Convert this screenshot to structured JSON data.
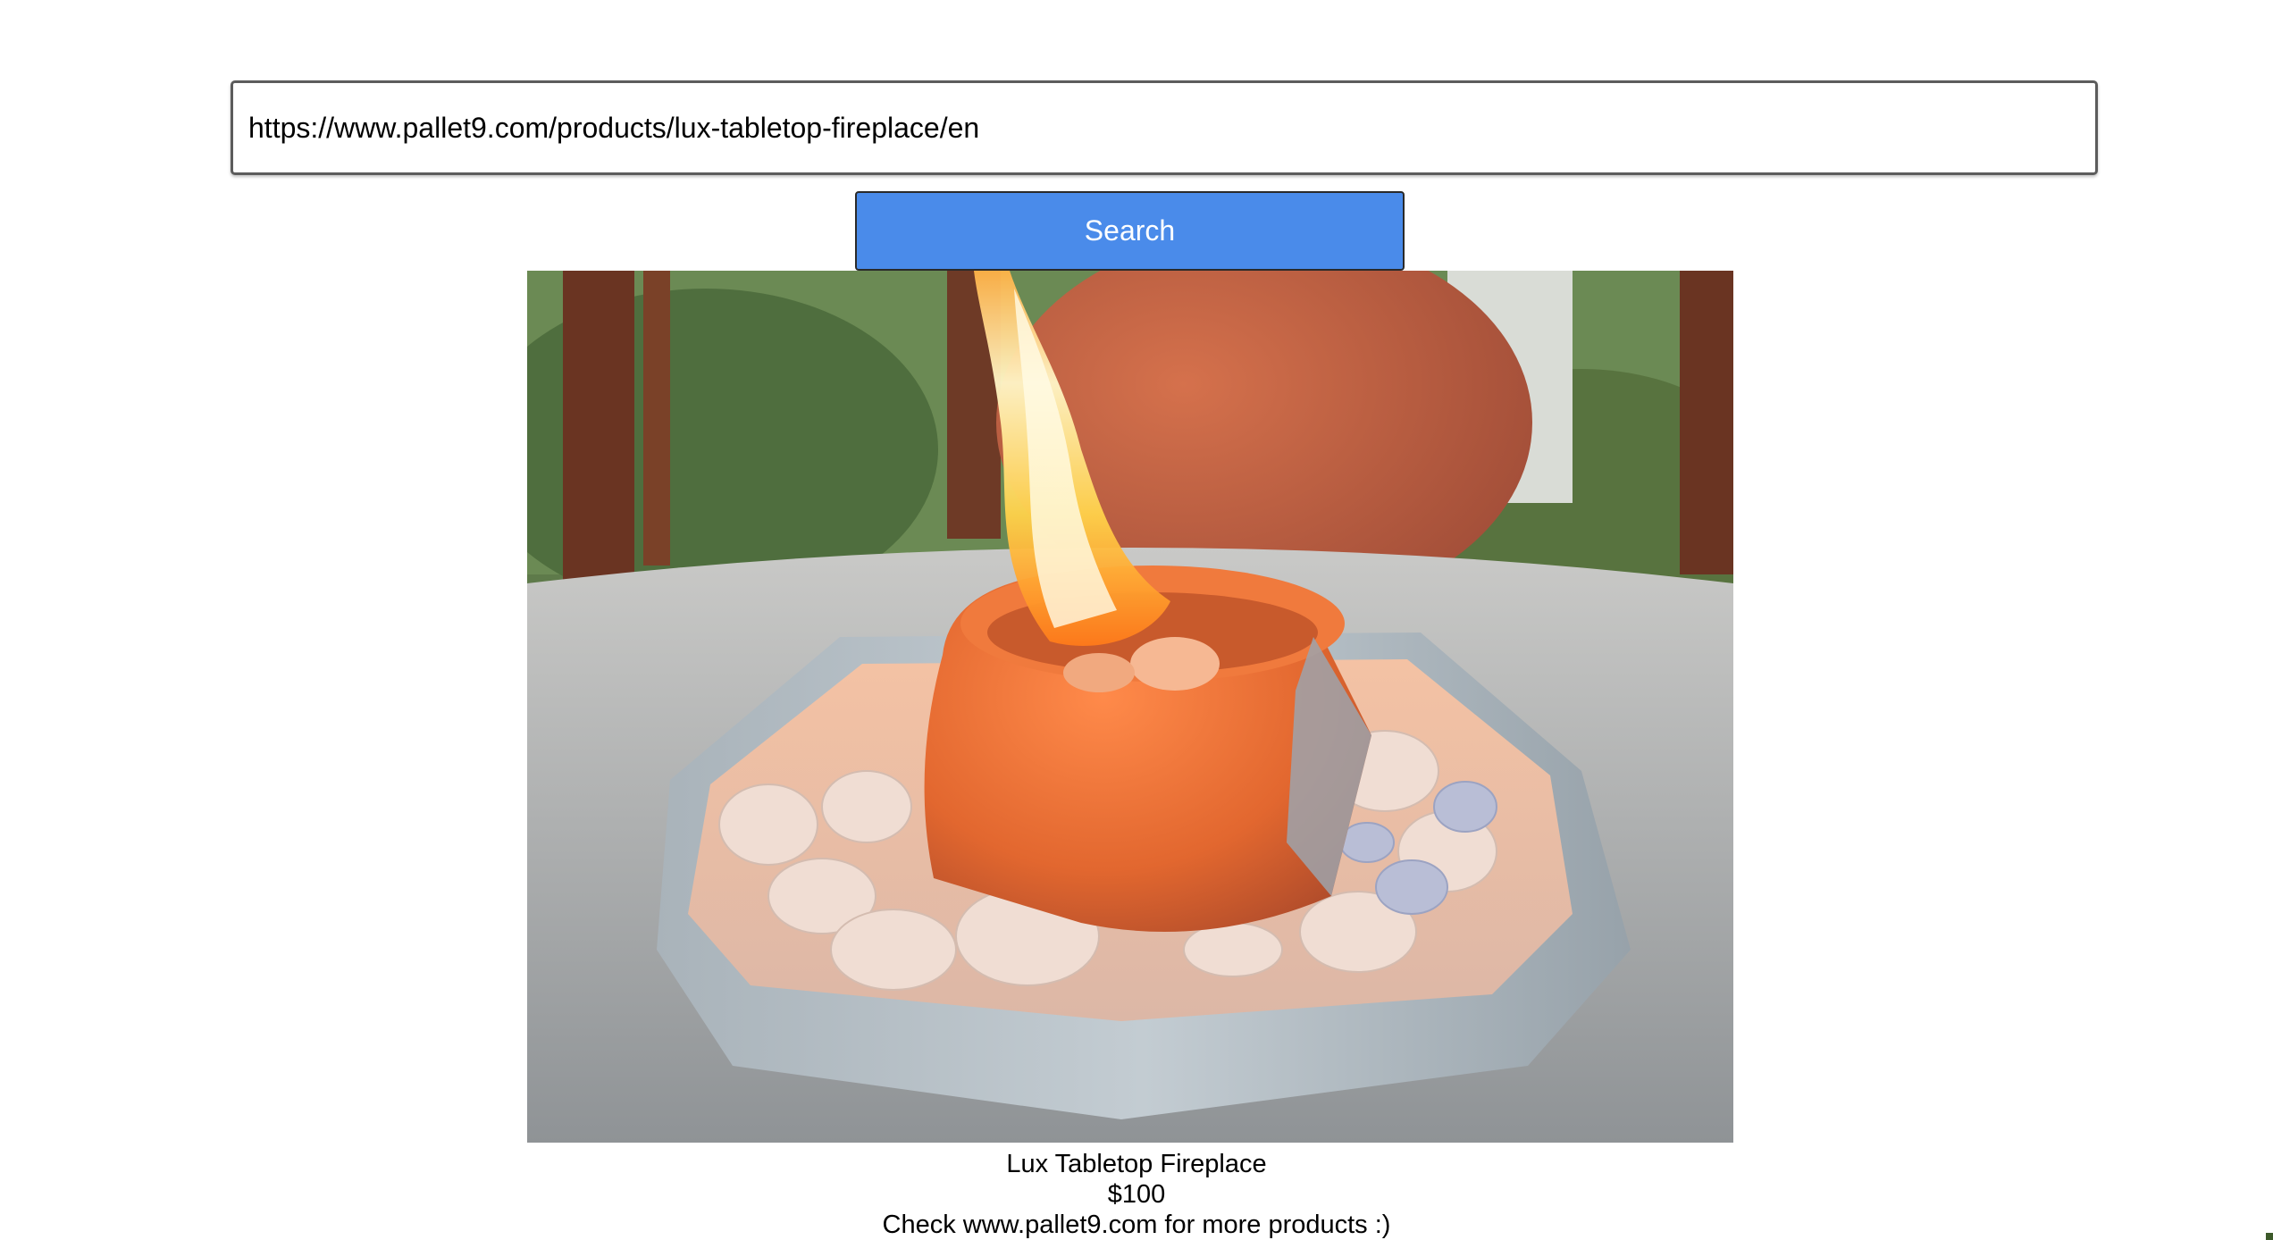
{
  "search": {
    "url_value": "https://www.pallet9.com/products/lux-tabletop-fireplace/en",
    "button_label": "Search"
  },
  "product": {
    "image_alt": "Lux Tabletop Fireplace",
    "name": "Lux Tabletop Fireplace",
    "price": "$100",
    "note": "Check www.pallet9.com for more products :)"
  },
  "colors": {
    "button_bg": "#4a8bea",
    "button_text": "#ffffff",
    "input_border": "#5c5c5c"
  }
}
